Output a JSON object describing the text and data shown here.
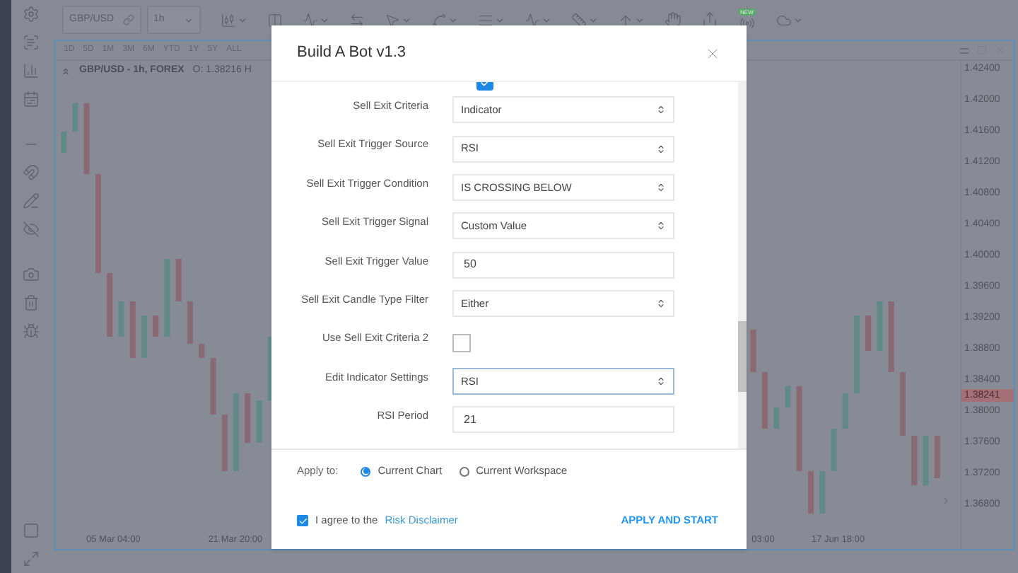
{
  "toolbar": {
    "symbol": "GBP/USD",
    "interval": "1h",
    "badge": "NEW"
  },
  "ranges": [
    {
      "label": "1D"
    },
    {
      "label": "5D"
    },
    {
      "label": "1M"
    },
    {
      "label": "3M"
    },
    {
      "label": "6M"
    },
    {
      "label": "YTD"
    },
    {
      "label": "1Y"
    },
    {
      "label": "5Y"
    },
    {
      "label": "ALL"
    }
  ],
  "chart": {
    "title": "GBP/USD - 1h, FOREX",
    "ohlc": "O: 1.38216 H",
    "current_price": "1.38241",
    "prices": [
      "1.42400",
      "1.42000",
      "1.41600",
      "1.41200",
      "1.40800",
      "1.40400",
      "1.40000",
      "1.39600",
      "1.39200",
      "1.38800",
      "1.38400",
      "1.38000",
      "1.37600",
      "1.37200",
      "1.36800"
    ],
    "dates": [
      "05 Mar 04:00",
      "21 Mar 20:00",
      "03:00",
      "17 Jun 18:00"
    ]
  },
  "modal": {
    "title": "Build A Bot v1.3",
    "top_checkbox": {
      "checked": true
    },
    "fields": [
      {
        "kind": "select",
        "label": "Sell Exit Criteria",
        "value": "Indicator"
      },
      {
        "kind": "select",
        "label": "Sell Exit Trigger Source",
        "value": "RSI"
      },
      {
        "kind": "select",
        "label": "Sell Exit Trigger Condition",
        "value": "IS CROSSING BELOW"
      },
      {
        "kind": "select",
        "label": "Sell Exit Trigger Signal",
        "value": "Custom Value"
      },
      {
        "kind": "input",
        "label": "Sell Exit Trigger Value",
        "value": "50"
      },
      {
        "kind": "select",
        "label": "Sell Exit Candle Type Filter",
        "value": "Either"
      },
      {
        "kind": "checkbox",
        "label": "Use Sell Exit Criteria 2",
        "checked": false
      },
      {
        "kind": "select",
        "label": "Edit Indicator Settings",
        "value": "RSI",
        "focused": true
      },
      {
        "kind": "input",
        "label": "RSI Period",
        "value": "21"
      }
    ],
    "apply_to": {
      "label": "Apply to:",
      "options": [
        {
          "label": "Current Chart",
          "selected": true
        },
        {
          "label": "Current Workspace",
          "selected": false
        }
      ]
    },
    "agree": {
      "checked": true,
      "text": "I agree to the",
      "link": "Risk Disclaimer"
    },
    "submit": "APPLY AND START"
  }
}
